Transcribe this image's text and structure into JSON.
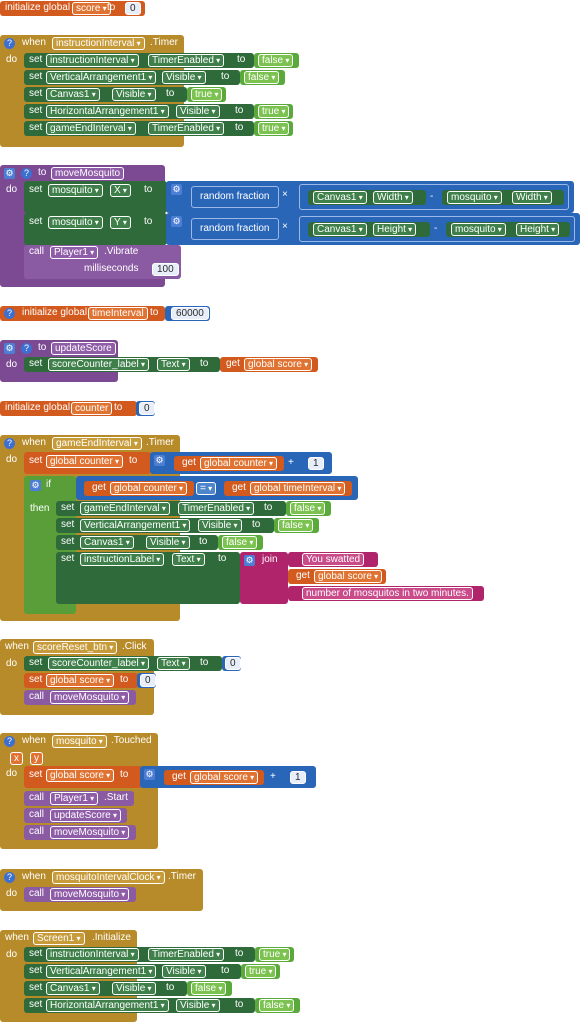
{
  "init_score": {
    "label": "initialize global",
    "name": "score",
    "to": "to",
    "value": "0"
  },
  "instr_timer": {
    "when": "when",
    "component": "instructionInterval",
    "event": ".Timer",
    "do": "do",
    "rows": [
      {
        "set": "set",
        "comp": "instructionInterval",
        "prop": "TimerEnabled",
        "to": "to",
        "val": "false"
      },
      {
        "set": "set",
        "comp": "VerticalArrangement1",
        "prop": "Visible",
        "to": "to",
        "val": "false"
      },
      {
        "set": "set",
        "comp": "Canvas1",
        "prop": "Visible",
        "to": "to",
        "val": "true"
      },
      {
        "set": "set",
        "comp": "HorizontalArrangement1",
        "prop": "Visible",
        "to": "to",
        "val": "true"
      },
      {
        "set": "set",
        "comp": "gameEndInterval",
        "prop": "TimerEnabled",
        "to": "to",
        "val": "true"
      }
    ]
  },
  "move_mosquito": {
    "to": "to",
    "name": "moveMosquito",
    "do": "do",
    "set": "set",
    "assign": "to",
    "x_row": {
      "comp": "mosquito",
      "prop": "X",
      "rand": "random fraction",
      "mul": "×",
      "minus": "-",
      "c1": "Canvas1",
      "p1": "Width",
      "c2": "mosquito",
      "p2": "Width"
    },
    "y_row": {
      "comp": "mosquito",
      "prop": "Y",
      "rand": "random fraction",
      "mul": "×",
      "minus": "-",
      "c1": "Canvas1",
      "p1": "Height",
      "c2": "mosquito",
      "p2": "Height"
    },
    "call": "call",
    "player": "Player1",
    "method": ".Vibrate",
    "ms_label": "milliseconds",
    "ms_value": "100"
  },
  "init_time": {
    "label": "initialize global",
    "name": "timeInterval",
    "to": "to",
    "value": "60000"
  },
  "update_score": {
    "to": "to",
    "name": "updateScore",
    "do": "do",
    "set": "set",
    "comp": "scoreCounter_label",
    "prop": "Text",
    "assign": "to",
    "get": "get",
    "var": "global score"
  },
  "init_counter": {
    "label": "initialize global",
    "name": "counter",
    "to": "to",
    "value": "0"
  },
  "game_end": {
    "when": "when",
    "component": "gameEndInterval",
    "event": ".Timer",
    "do": "do",
    "set": "set",
    "var": "global counter",
    "assign": "to",
    "get": "get",
    "plus": "+",
    "one": "1",
    "if": "if",
    "then": "then",
    "eq": "=",
    "timevar": "global timeInterval",
    "rows": [
      {
        "set": "set",
        "comp": "gameEndInterval",
        "prop": "TimerEnabled",
        "to": "to",
        "val": "false"
      },
      {
        "set": "set",
        "comp": "VerticalArrangement1",
        "prop": "Visible",
        "to": "to",
        "val": "false"
      },
      {
        "set": "set",
        "comp": "Canvas1",
        "prop": "Visible",
        "to": "to",
        "val": "false"
      }
    ],
    "label_row": {
      "set": "set",
      "comp": "instructionLabel",
      "prop": "Text",
      "to": "to",
      "join": "join",
      "s1": "You swatted",
      "getvar": "global score",
      "s2": "number of mosquitos in two minutes."
    }
  },
  "reset_click": {
    "when": "when",
    "component": "scoreReset_btn",
    "event": ".Click",
    "do": "do",
    "set": "set",
    "comp": "scoreCounter_label",
    "prop": "Text",
    "to": "to",
    "zero": "0",
    "var": "global score",
    "call": "call",
    "proc": "moveMosquito"
  },
  "mosq_touched": {
    "when": "when",
    "component": "mosquito",
    "event": ".Touched",
    "p1": "x",
    "p2": "y",
    "do": "do",
    "set": "set",
    "var": "global score",
    "to": "to",
    "get": "get",
    "plus": "+",
    "one": "1",
    "call": "call",
    "player": "Player1",
    "start": ".Start",
    "c2": "updateScore",
    "c3": "moveMosquito"
  },
  "mosq_clock": {
    "when": "when",
    "component": "mosquitoIntervalClock",
    "event": ".Timer",
    "do": "do",
    "call": "call",
    "proc": "moveMosquito"
  },
  "screen_init": {
    "when": "when",
    "component": "Screen1",
    "event": ".Initialize",
    "do": "do",
    "rows": [
      {
        "set": "set",
        "comp": "instructionInterval",
        "prop": "TimerEnabled",
        "to": "to",
        "val": "true"
      },
      {
        "set": "set",
        "comp": "VerticalArrangement1",
        "prop": "Visible",
        "to": "to",
        "val": "true"
      },
      {
        "set": "set",
        "comp": "Canvas1",
        "prop": "Visible",
        "to": "to",
        "val": "false"
      },
      {
        "set": "set",
        "comp": "HorizontalArrangement1",
        "prop": "Visible",
        "to": "to",
        "val": "false"
      }
    ]
  },
  "colors": {
    "event": "#b88b2a",
    "setter": "#2f6b3a",
    "procedure": "#7b4a93",
    "variable": "#d35a1e",
    "math": "#2a66b8",
    "logic": "#5aa93b",
    "text": "#b0246c"
  }
}
